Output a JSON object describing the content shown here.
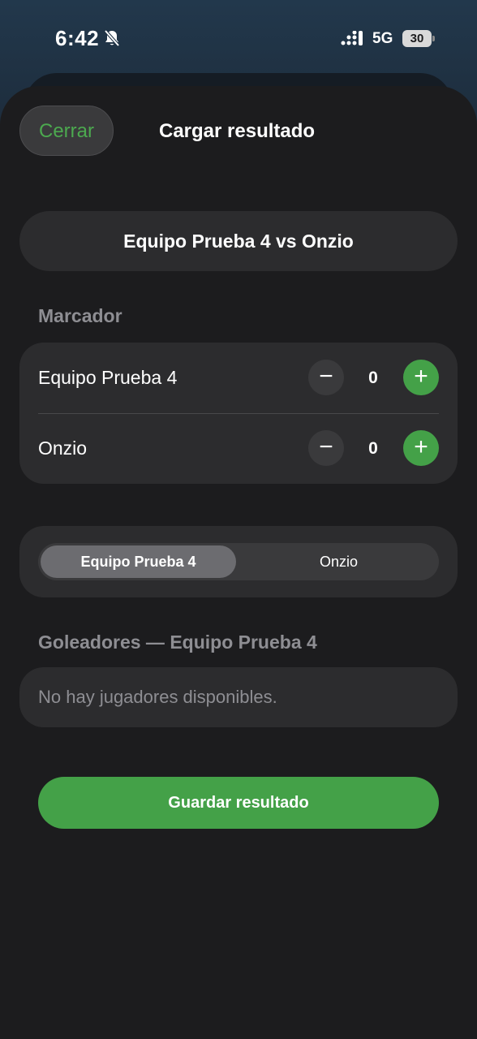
{
  "status_bar": {
    "time": "6:42",
    "network": "5G",
    "battery": "30",
    "icons": [
      "bell-slash-icon",
      "signal-icon",
      "battery-icon"
    ]
  },
  "sheet": {
    "close_label": "Cerrar",
    "title": "Cargar resultado"
  },
  "match": {
    "title": "Equipo Prueba 4 vs Onzio"
  },
  "scoreboard": {
    "label": "Marcador",
    "teams": [
      {
        "name": "Equipo Prueba 4",
        "score": "0",
        "minus": "−",
        "plus": "+"
      },
      {
        "name": "Onzio",
        "score": "0",
        "minus": "−",
        "plus": "+"
      }
    ]
  },
  "team_selector": {
    "options": [
      "Equipo Prueba 4",
      "Onzio"
    ],
    "selected": "Equipo Prueba 4"
  },
  "scorers": {
    "label": "Goleadores — Equipo Prueba 4",
    "empty_text": "No hay jugadores disponibles."
  },
  "save_button": "Guardar resultado",
  "colors": {
    "accent_green": "#44a148",
    "close_text_green": "#4ca94f",
    "sheet_bg": "#1c1c1e",
    "card_bg": "#2c2c2e"
  }
}
